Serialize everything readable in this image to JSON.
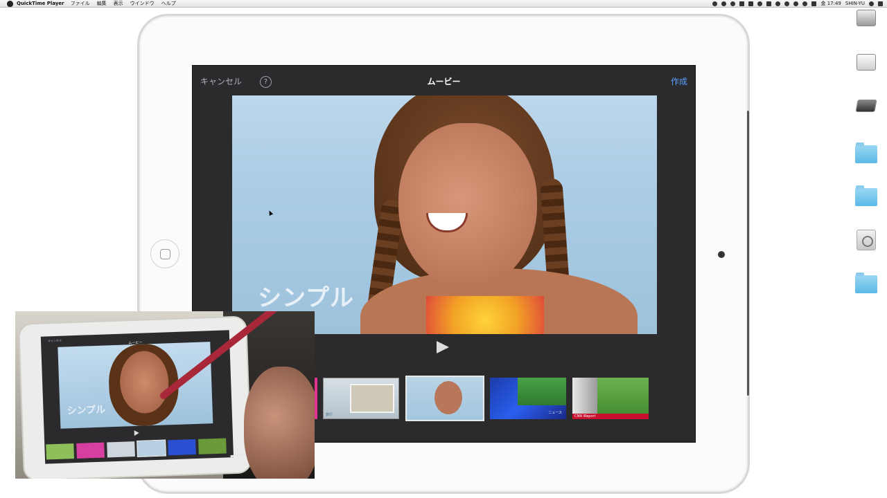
{
  "menubar": {
    "app_name": "QuickTime Player",
    "menus": [
      "ファイル",
      "編集",
      "表示",
      "ウインドウ",
      "ヘルプ"
    ],
    "time": "金 17:49",
    "user": "SHIN-YU"
  },
  "app": {
    "cancel_label": "キャンセル",
    "help_label": "?",
    "title": "ムービー",
    "create_label": "作成",
    "theme_title": "シンプル",
    "themes": [
      {
        "caption": "旅行"
      },
      {
        "caption": ""
      },
      {
        "caption": "ニュース"
      },
      {
        "caption": "CNN iReport"
      }
    ]
  },
  "inset": {
    "cancel_label": "キャンセル",
    "title": "ムービー",
    "theme_title": "シンプル"
  },
  "colors": {
    "accent": "#5aa0ff",
    "screen_bg": "#2b2b2d"
  }
}
